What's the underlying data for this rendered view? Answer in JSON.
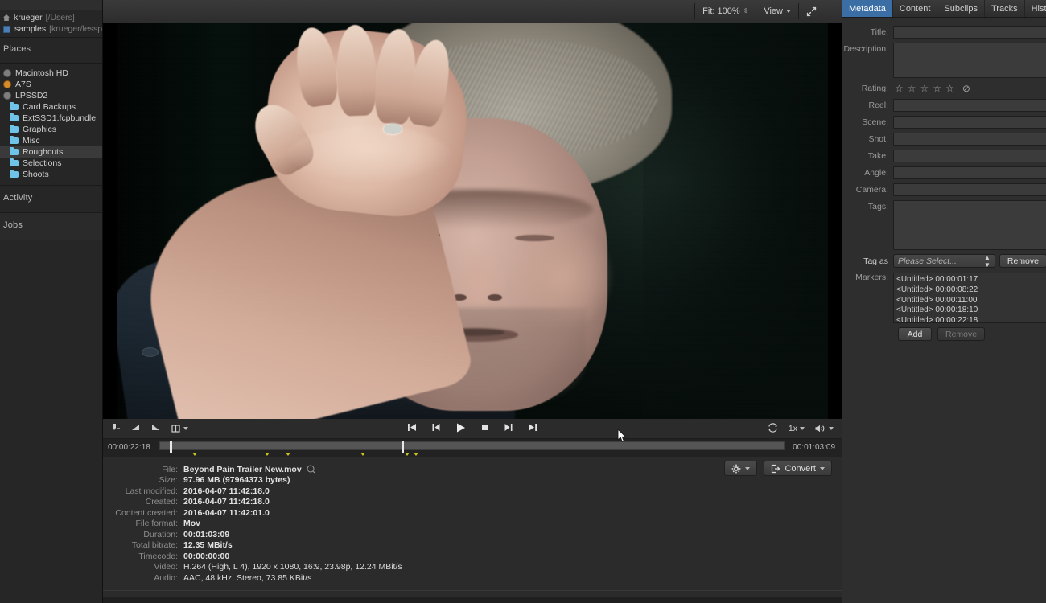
{
  "sidebar": {
    "user_rows": [
      {
        "icon": "home-icon",
        "label": "krueger",
        "sub": "[/Users]"
      },
      {
        "icon": "blue-folder-icon",
        "label": "samples",
        "sub": "[krueger/lesspain]"
      }
    ],
    "places_header": "Places",
    "volumes": [
      {
        "icon": "disk-icon",
        "label": "Macintosh HD"
      },
      {
        "icon": "disk-icon-orange",
        "label": "A7S"
      },
      {
        "icon": "disk-icon",
        "label": "LPSSD2"
      }
    ],
    "folders": [
      {
        "icon": "folder-icon",
        "label": "Card Backups",
        "selected": false
      },
      {
        "icon": "folder-icon",
        "label": "ExtSSD1.fcpbundle",
        "selected": false
      },
      {
        "icon": "folder-icon",
        "label": "Graphics",
        "selected": false
      },
      {
        "icon": "folder-icon",
        "label": "Misc",
        "selected": false
      },
      {
        "icon": "folder-icon",
        "label": "Roughcuts",
        "selected": true
      },
      {
        "icon": "folder-icon",
        "label": "Selections",
        "selected": false
      },
      {
        "icon": "folder-icon",
        "label": "Shoots",
        "selected": false
      }
    ],
    "activity_header": "Activity",
    "jobs_header": "Jobs"
  },
  "viewer_toolbar": {
    "fit_label": "Fit: 100%",
    "view_label": "View",
    "fullscreen_icon": "expand-arrows-icon"
  },
  "transport": {
    "mark_in_icon": "mark-in-icon",
    "in_point_icon": "in-point-icon",
    "out_point_icon": "out-point-icon",
    "range_icon": "range-marker-icon",
    "first_frame_icon": "skip-to-start-icon",
    "prev_frame_icon": "step-back-icon",
    "play_icon": "play-icon",
    "stop_icon": "stop-icon",
    "next_frame_icon": "step-forward-icon",
    "last_frame_icon": "skip-to-end-icon",
    "loop_icon": "loop-icon",
    "speed_label": "1x",
    "volume_icon": "speaker-icon"
  },
  "scrubber": {
    "current_time": "00:00:22:18",
    "total_time": "00:01:03:09",
    "playhead_percent": 38.6,
    "in_marker_percent": 1.5,
    "markers_percent": [
      5.2,
      16.8,
      20.1,
      32.1,
      39.2,
      40.6
    ]
  },
  "file_info": {
    "rows": [
      {
        "key": "File:",
        "value": "Beyond Pain Trailer New.mov",
        "has_icon": true
      },
      {
        "key": "Size:",
        "value": "97.96 MB (97964373 bytes)"
      },
      {
        "key": "Last modified:",
        "value": "2016-04-07 11:42:18.0"
      },
      {
        "key": "Created:",
        "value": "2016-04-07 11:42:18.0"
      },
      {
        "key": "Content created:",
        "value": "2016-04-07 11:42:01.0"
      },
      {
        "key": "File format:",
        "value": "Mov"
      },
      {
        "key": "Duration:",
        "value": "00:01:03:09"
      },
      {
        "key": "Total bitrate:",
        "value": "12.35 MBit/s"
      },
      {
        "key": "Timecode:",
        "value": "00:00:00:00"
      },
      {
        "key": "Video:",
        "value": "H.264 (High, L 4), 1920 x 1080, 16:9, 23.98p, 12.24 MBit/s"
      },
      {
        "key": "Audio:",
        "value": "AAC, 48 kHz, Stereo, 73.85 KBit/s"
      }
    ],
    "magnify_icon": "magnifier-icon",
    "gear_label": "",
    "gear_icon": "gear-icon",
    "convert_label": "Convert",
    "convert_icon": "export-box-icon"
  },
  "right_panel": {
    "tabs": [
      {
        "label": "Metadata",
        "active": true
      },
      {
        "label": "Content",
        "active": false
      },
      {
        "label": "Subclips",
        "active": false
      },
      {
        "label": "Tracks",
        "active": false
      },
      {
        "label": "Histogram",
        "active": false
      }
    ],
    "fields": [
      {
        "label": "Title:",
        "value": "",
        "type": "text"
      },
      {
        "label": "Description:",
        "value": "",
        "type": "textarea"
      },
      {
        "label": "Rating:",
        "value": "",
        "type": "rating"
      },
      {
        "label": "Reel:",
        "value": "",
        "type": "text"
      },
      {
        "label": "Scene:",
        "value": "",
        "type": "text"
      },
      {
        "label": "Shot:",
        "value": "",
        "type": "text"
      },
      {
        "label": "Take:",
        "value": "",
        "type": "text"
      },
      {
        "label": "Angle:",
        "value": "",
        "type": "text"
      },
      {
        "label": "Camera:",
        "value": "",
        "type": "text"
      },
      {
        "label": "Tags:",
        "value": "",
        "type": "tags"
      }
    ],
    "rating": {
      "stars": 5,
      "filled": 0,
      "clear_icon": "no-rating-icon"
    },
    "tag_as": {
      "label": "Tag as",
      "selected": "Please Select...",
      "button_label": "Remove"
    },
    "markers": {
      "label": "Markers:",
      "items": [
        {
          "name": "<Untitled>",
          "time": "00:00:01:17"
        },
        {
          "name": "<Untitled>",
          "time": "00:00:08:22"
        },
        {
          "name": "<Untitled>",
          "time": "00:00:11:00"
        },
        {
          "name": "<Untitled>",
          "time": "00:00:18:10"
        },
        {
          "name": "<Untitled>",
          "time": "00:00:22:18"
        }
      ],
      "add_label": "Add",
      "remove_label": "Remove"
    }
  },
  "colors": {
    "accent_blue": "#3a6ea5",
    "panel_bg": "#2e2e2e",
    "sidebar_bg": "#262626",
    "marker_yellow": "#c8c420",
    "folder_blue": "#6fc3e8"
  }
}
